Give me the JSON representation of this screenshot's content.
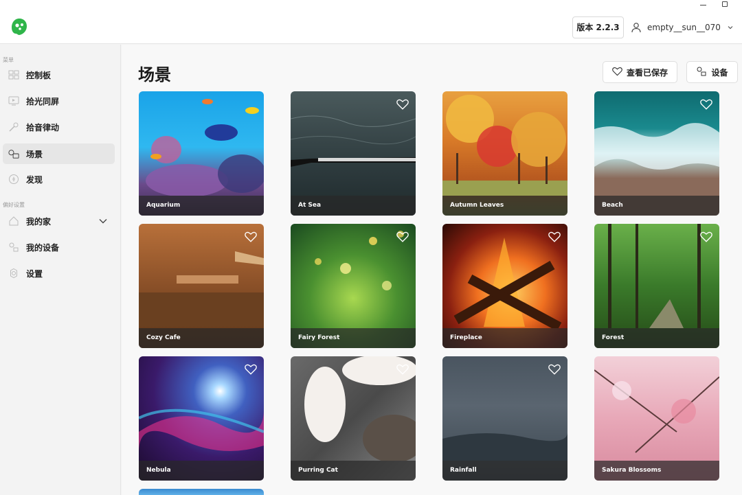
{
  "window": {
    "minimize_glyph": "—"
  },
  "header": {
    "version_label": "版本 2.2.3",
    "username": "empty__sun__070"
  },
  "sidebar": {
    "section_menu": "菜单",
    "section_prefs": "偏好设置",
    "items": [
      {
        "label": "控制板",
        "icon": "dashboard-icon"
      },
      {
        "label": "拾光同屏",
        "icon": "screen-sync-icon"
      },
      {
        "label": "拾音律动",
        "icon": "microphone-icon"
      },
      {
        "label": "场景",
        "icon": "scene-icon",
        "active": true
      },
      {
        "label": "发现",
        "icon": "compass-icon"
      }
    ],
    "pref_items": [
      {
        "label": "我的家",
        "icon": "home-icon",
        "expandable": true
      },
      {
        "label": "我的设备",
        "icon": "devices-icon"
      },
      {
        "label": "设置",
        "icon": "gear-icon"
      }
    ]
  },
  "main": {
    "title": "场景",
    "saved_button": "查看已保存",
    "device_button": "设备",
    "scenes": [
      {
        "name": "Aquarium"
      },
      {
        "name": "At Sea"
      },
      {
        "name": "Autumn Leaves"
      },
      {
        "name": "Beach"
      },
      {
        "name": "Cozy Cafe"
      },
      {
        "name": "Fairy Forest"
      },
      {
        "name": "Fireplace"
      },
      {
        "name": "Forest"
      },
      {
        "name": "Nebula"
      },
      {
        "name": "Purring Cat"
      },
      {
        "name": "Rainfall"
      },
      {
        "name": "Sakura Blossoms"
      }
    ]
  },
  "colors": {
    "brand_green": "#2fb54a",
    "sidebar_active": "#e6e6e6"
  }
}
